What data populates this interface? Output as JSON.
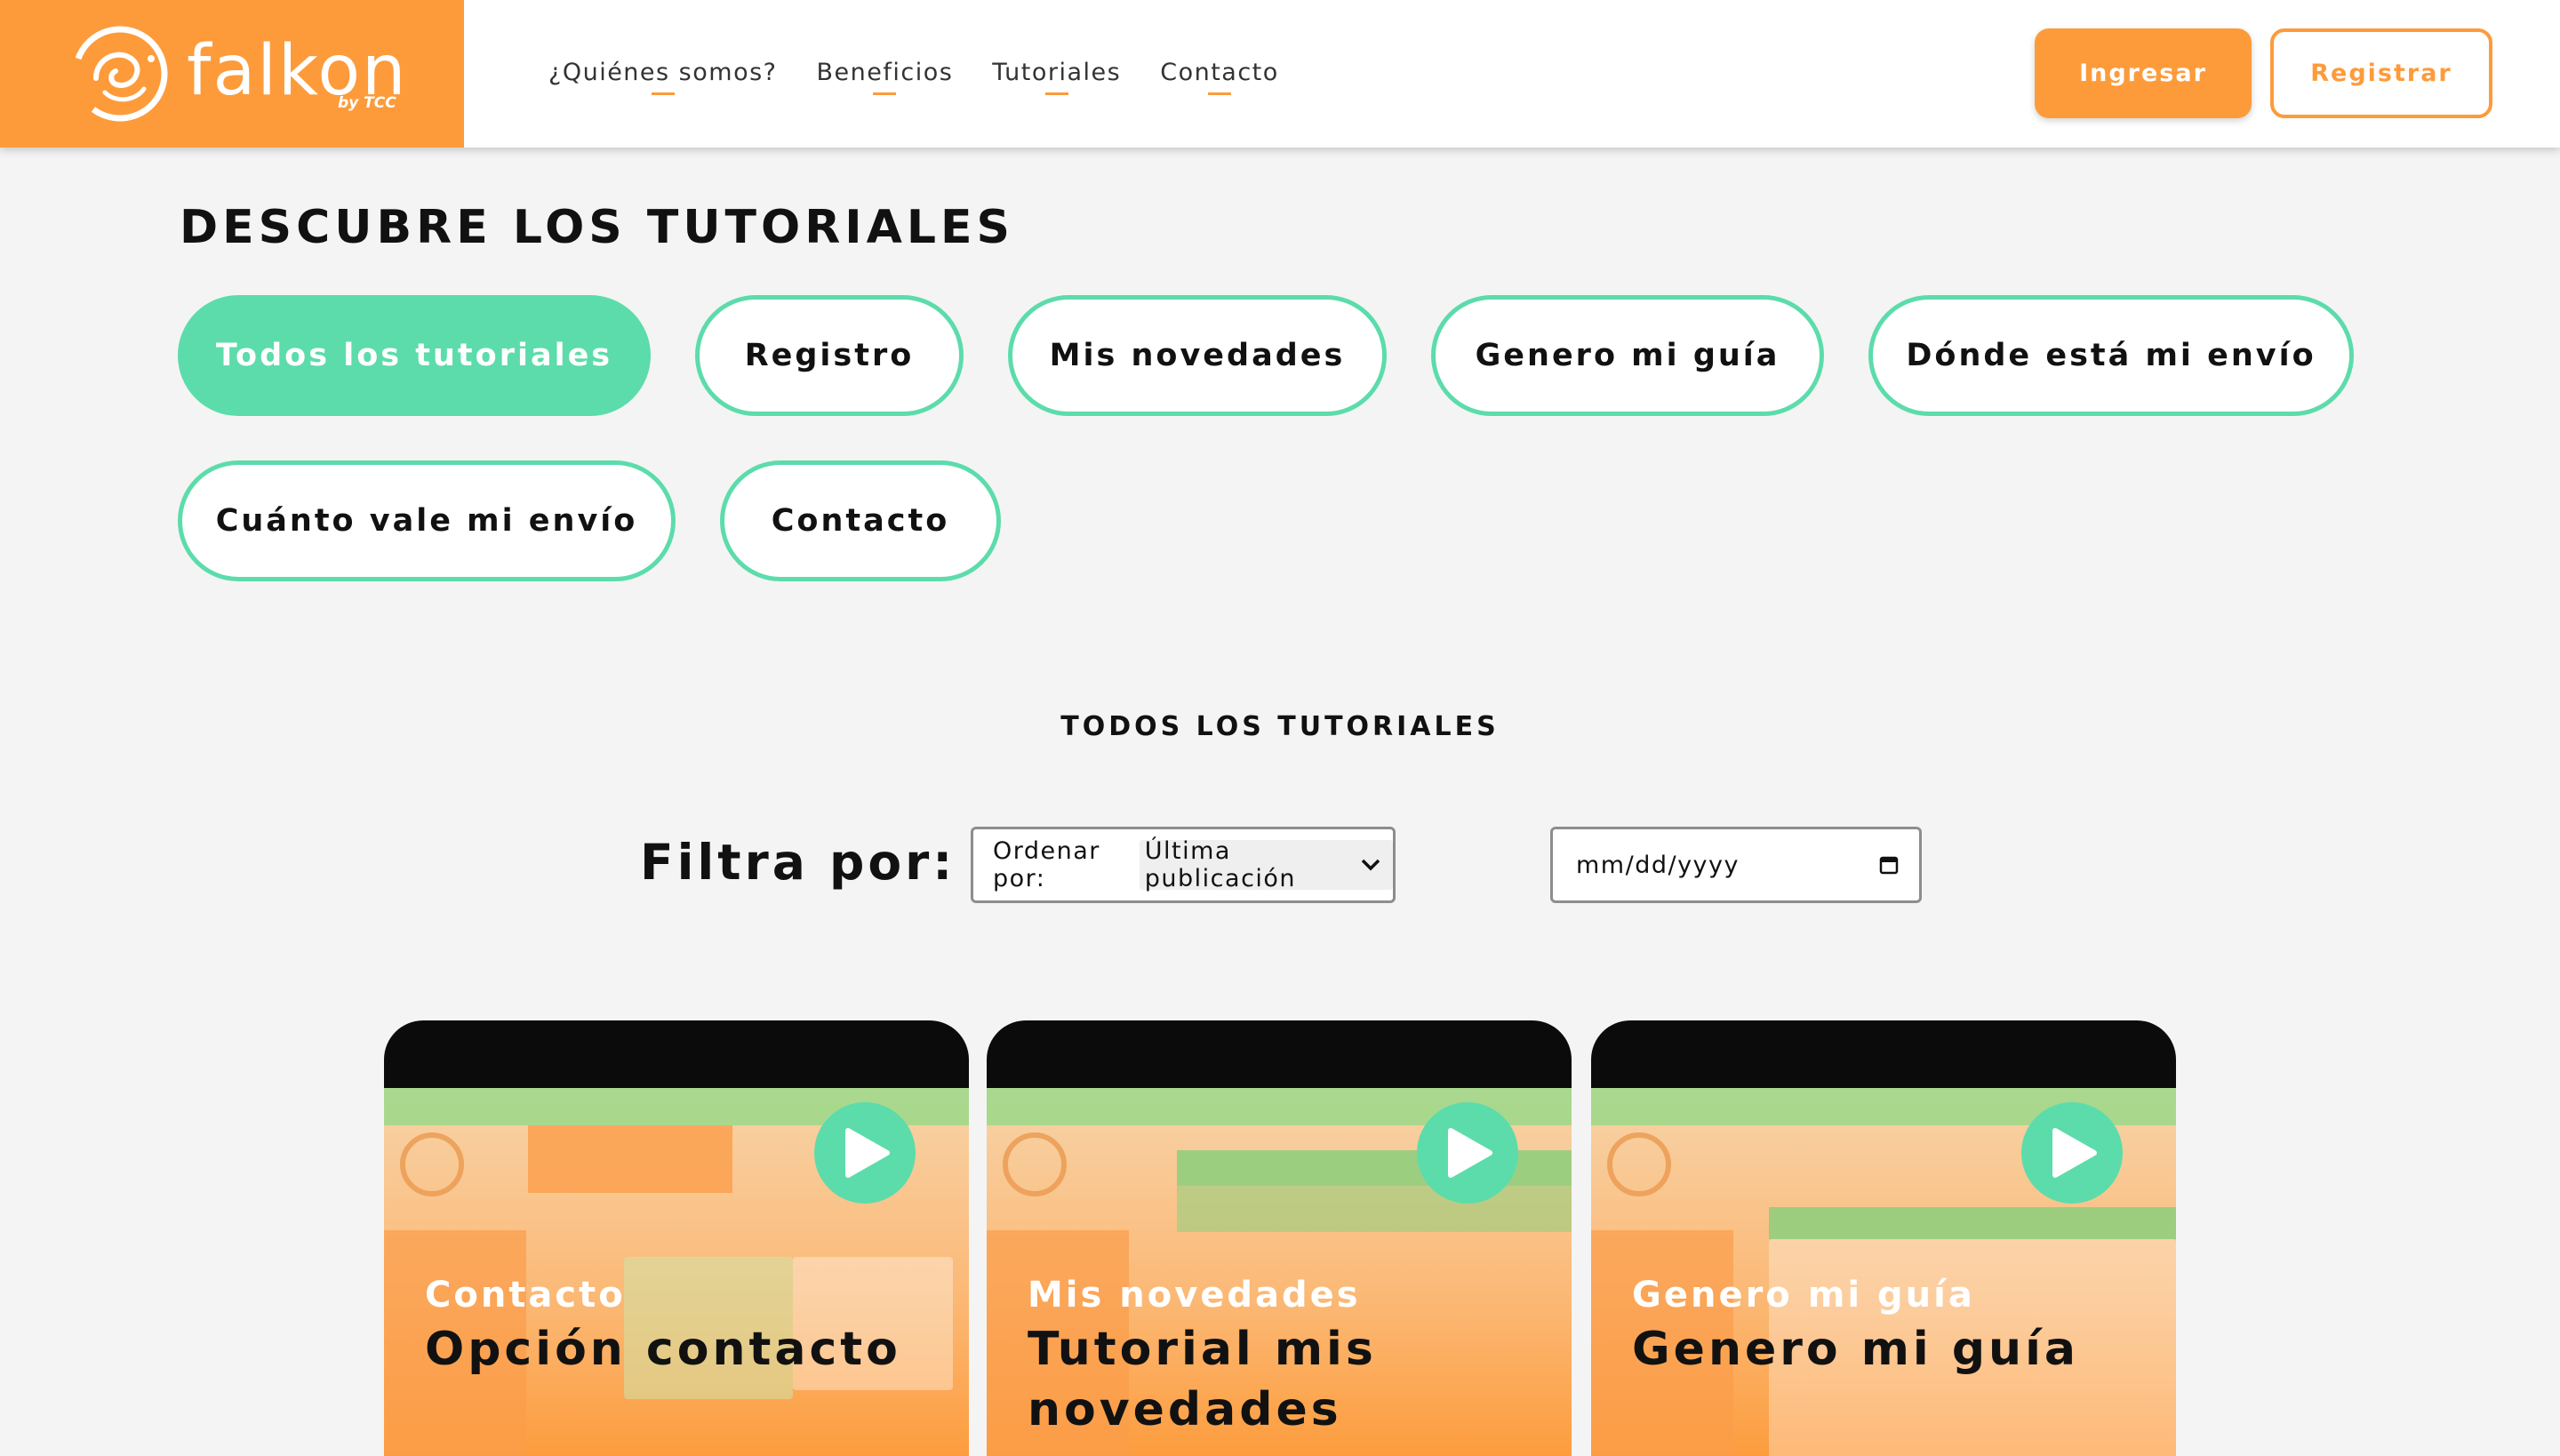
{
  "header": {
    "logo_word": "falkon",
    "logo_sub": "by TCC",
    "nav": [
      "¿Quiénes somos?",
      "Beneficios",
      "Tutoriales",
      "Contacto"
    ],
    "login_label": "Ingresar",
    "register_label": "Registrar"
  },
  "hero": {
    "title": "DESCUBRE LOS TUTORIALES",
    "categories": [
      {
        "label": "Todos los tutoriales",
        "active": true
      },
      {
        "label": "Registro",
        "active": false
      },
      {
        "label": "Mis novedades",
        "active": false
      },
      {
        "label": "Genero mi guía",
        "active": false
      },
      {
        "label": "Dónde está mi envío",
        "active": false
      },
      {
        "label": "Cuánto vale mi envío",
        "active": false
      },
      {
        "label": "Contacto",
        "active": false
      }
    ]
  },
  "list": {
    "heading": "TODOS LOS TUTORIALES"
  },
  "filters": {
    "label": "Filtra por:",
    "sort_prefix": "Ordenar por:",
    "sort_value": "Última publicación",
    "date_placeholder": "mm/dd/yyyy"
  },
  "cards": [
    {
      "category": "Contacto",
      "title": "Opción contacto"
    },
    {
      "category": "Mis novedades",
      "title": "Tutorial mis novedades"
    },
    {
      "category": "Genero mi guía",
      "title": "Genero mi guía"
    }
  ],
  "colors": {
    "brand_orange": "#fd9b3b",
    "accent_green": "#5cdcab"
  },
  "icons": [
    "falkon-logo-icon",
    "chevron-down-icon",
    "calendar-icon",
    "play-icon"
  ]
}
